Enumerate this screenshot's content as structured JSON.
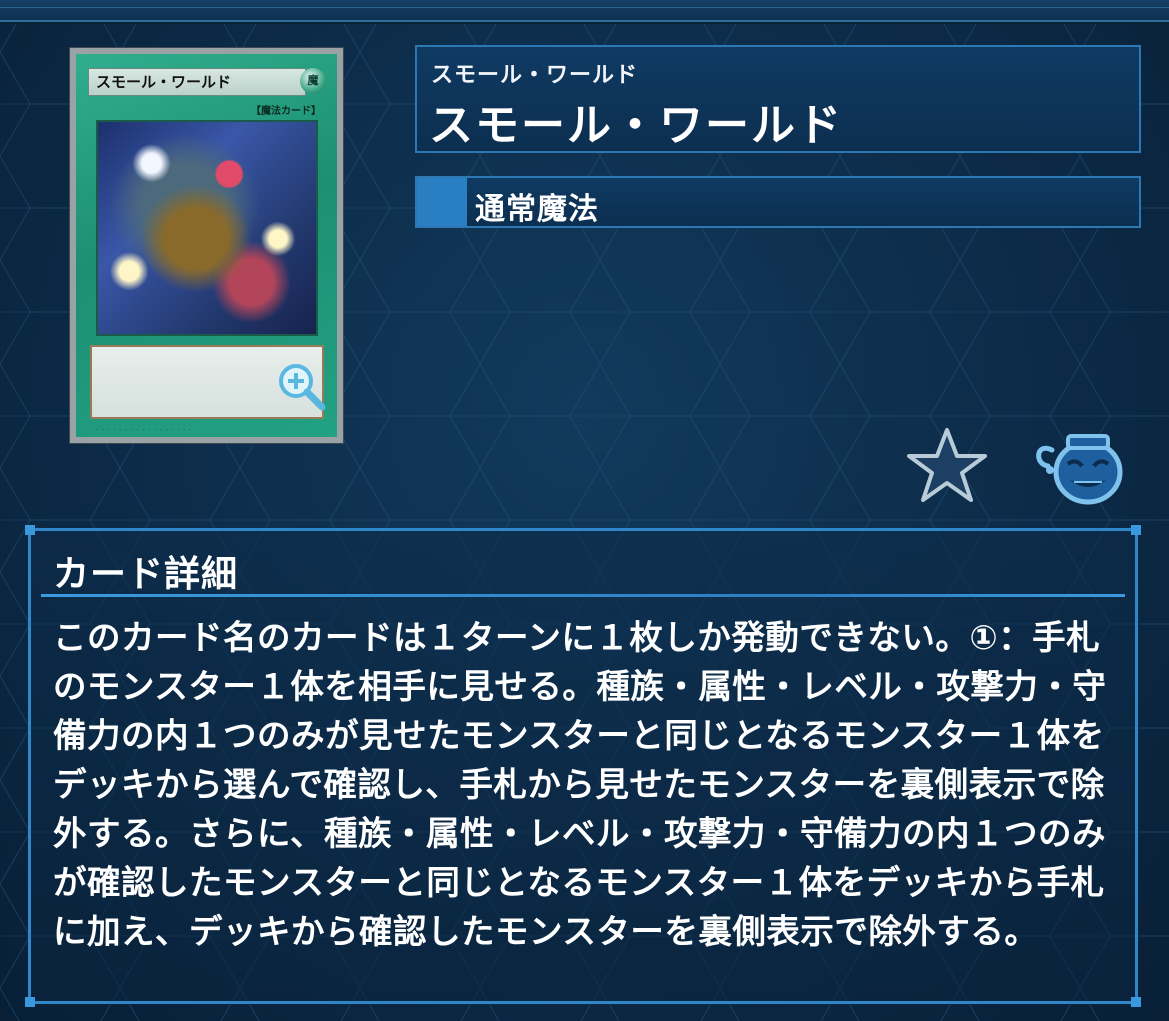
{
  "card": {
    "image_name_text": "スモール・ワールド",
    "image_type_text": "【魔法カード】",
    "zoom_icon": "zoom-in-magnifier-icon"
  },
  "header": {
    "name_ruby": "スモール・ワールド",
    "name": "スモール・ワールド",
    "type": "通常魔法",
    "type_color": "#2a7fc2"
  },
  "actions": {
    "favorite_icon": "star-icon",
    "pot_icon": "pot-of-greed-icon"
  },
  "detail": {
    "title": "カード詳細",
    "text": "このカード名のカードは１ターンに１枚しか発動できない。①：手札のモンスター１体を相手に見せる。種族・属性・レベル・攻撃力・守備力の内１つのみが見せたモンスターと同じとなるモンスター１体をデッキから選んで確認し、手札から見せたモンスターを裏側表示で除外する。さらに、種族・属性・レベル・攻撃力・守備力の内１つのみが確認したモンスターと同じとなるモンスター１体をデッキから手札に加え、デッキから確認したモンスターを裏側表示で除外する。"
  },
  "colors": {
    "background": "#0c2b48",
    "panel_border": "#2f86c8",
    "card_frame": "#1d8f72"
  }
}
